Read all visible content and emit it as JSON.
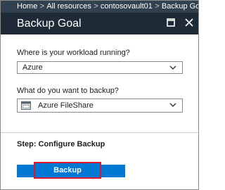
{
  "breadcrumb": {
    "items": [
      "Home",
      "All resources",
      "contosovault01",
      "Backup Goal"
    ],
    "separator": ">"
  },
  "blade": {
    "title": "Backup Goal",
    "icons": [
      "maximize-icon",
      "close-icon"
    ]
  },
  "form": {
    "workload": {
      "label": "Where is your workload running?",
      "value": "Azure"
    },
    "backup_item": {
      "label": "What do you want to backup?",
      "value": "Azure FileShare",
      "icon": "fileshare-icon"
    }
  },
  "step": {
    "label": "Step: Configure Backup",
    "button_label": "Backup"
  },
  "colors": {
    "breadcrumb_bg": "#32414f",
    "header_bg": "#1e2a36",
    "accent": "#0078d4",
    "highlight": "#e0162b"
  }
}
